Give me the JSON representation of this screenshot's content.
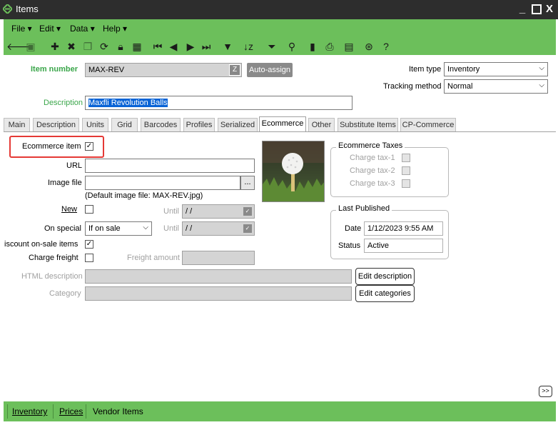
{
  "window": {
    "title": "Items",
    "minimize": "_",
    "maximize": "☐",
    "close": "X"
  },
  "menu": [
    {
      "label": "File"
    },
    {
      "label": "Edit"
    },
    {
      "label": "Data"
    },
    {
      "label": "Help"
    }
  ],
  "item_number": {
    "label": "Item number",
    "value": "MAX-REV",
    "auto_assign": "Auto-assign"
  },
  "description": {
    "label": "Description",
    "value": "Maxfli Revolution Balls"
  },
  "item_type": {
    "label": "Item type",
    "value": "Inventory"
  },
  "tracking_method": {
    "label": "Tracking method",
    "value": "Normal"
  },
  "tabs": [
    "Main",
    "Description",
    "Units",
    "Grid",
    "Barcodes",
    "Profiles",
    "Serialized",
    "Ecommerce",
    "Other",
    "Substitute Items",
    "CP-Commerce"
  ],
  "ecommerce": {
    "ecommerce_item_label": "Ecommerce item",
    "url_label": "URL",
    "url_value": "",
    "image_file_label": "Image file",
    "image_file_value": "",
    "browse": "...",
    "default_image_note": "(Default image file: MAX-REV.jpg)",
    "new_label": "New",
    "until_label": "Until",
    "until_value": " / /",
    "on_special_label": "On special",
    "on_special_value": "If on sale",
    "discount_label": "iscount on-sale items",
    "charge_freight_label": "Charge freight",
    "freight_amount_label": "Freight amount",
    "html_description_label": "HTML description",
    "edit_description": "Edit description",
    "category_label": "Category",
    "edit_categories": "Edit categories"
  },
  "taxes": {
    "title": "Ecommerce Taxes",
    "items": [
      "Charge tax-1",
      "Charge tax-2",
      "Charge tax-3"
    ]
  },
  "last_published": {
    "title": "Last Published",
    "date_label": "Date",
    "date_value": "1/12/2023 9:55 AM",
    "status_label": "Status",
    "status_value": "Active"
  },
  "expand_button": ">>",
  "bottom_tabs": [
    "Inventory",
    "Prices",
    "Vendor Items"
  ],
  "colors": {
    "accent": "#6cbf5b",
    "label_green": "#3aa64a",
    "highlight": "#e53935"
  }
}
